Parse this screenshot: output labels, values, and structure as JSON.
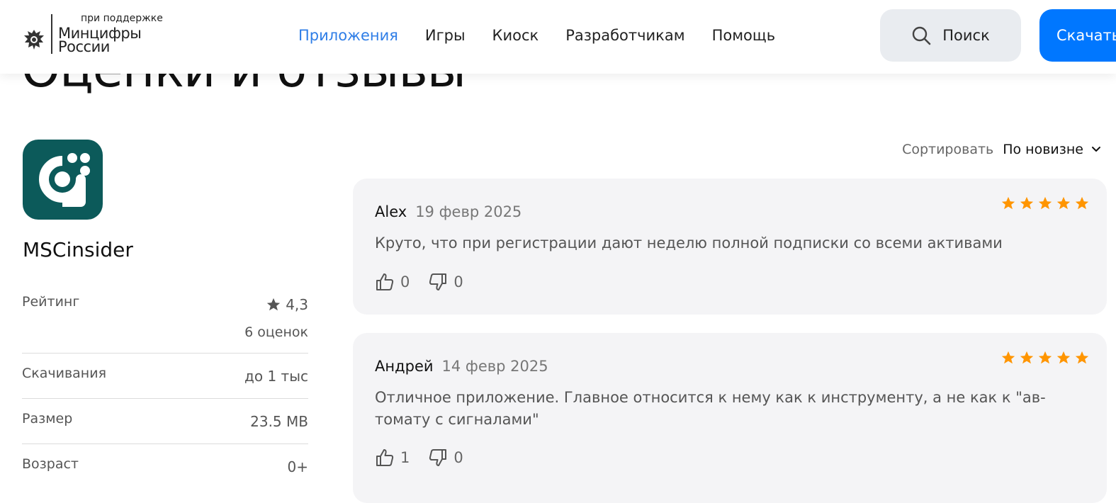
{
  "header": {
    "logo_small": "при поддержке",
    "logo_line1": "Минцифры",
    "logo_line2": "России",
    "nav": [
      {
        "label": "Приложения",
        "active": true
      },
      {
        "label": "Игры"
      },
      {
        "label": "Киоск"
      },
      {
        "label": "Разработчикам"
      },
      {
        "label": "Помощь"
      }
    ],
    "search_label": "Поиск",
    "download_label": "Скачать"
  },
  "page": {
    "title": "Оценки и отзывы"
  },
  "app": {
    "name": "MSCinsider",
    "rating_label": "Рейтинг",
    "rating_value": "4,3",
    "rating_count": "6 оценок",
    "downloads_label": "Скачивания",
    "downloads_value": "до 1 тыс",
    "size_label": "Размер",
    "size_value": "23.5 MB",
    "age_label": "Возраст",
    "age_value": "0+"
  },
  "sort": {
    "label": "Сортировать",
    "value": "По новизне"
  },
  "reviews": [
    {
      "author": "Alex",
      "date": "19 февр 2025",
      "stars": 5,
      "text": "Круто, что при регистрации дают неделю полной подписки со всеми активами",
      "likes": "0",
      "dislikes": "0"
    },
    {
      "author": "Андрей",
      "date": "14 февр 2025",
      "stars": 5,
      "text": "Отличное приложение. Главное относится к нему как к инструменту, а не как к \"ав-томату с сигналами\"",
      "likes": "1",
      "dislikes": "0"
    }
  ],
  "colors": {
    "accent": "#0077ff",
    "nav_active": "#2f7ee7",
    "star": "#ff9500",
    "app_icon_bg": "#0c5a5a"
  },
  "icons": {
    "emblem": "russian-emblem-icon",
    "search": "search-icon",
    "sort": "chevron-down-icon",
    "rating": "star-icon",
    "like": "thumbs-up-icon",
    "dislike": "thumbs-down-icon"
  }
}
